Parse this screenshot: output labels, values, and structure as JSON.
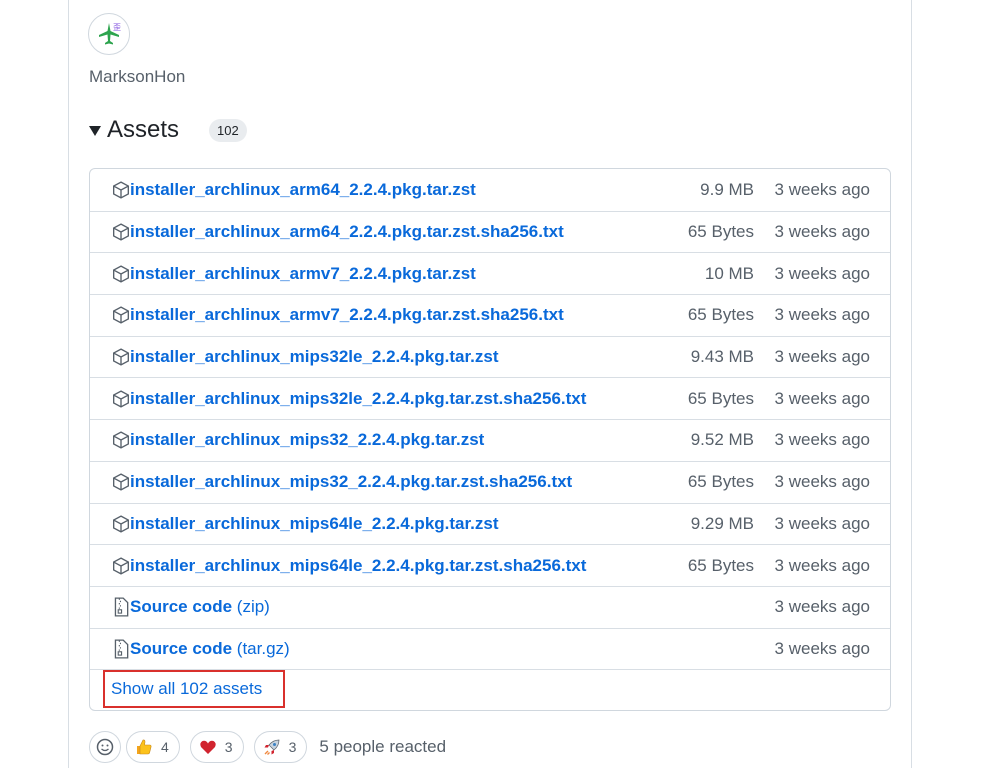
{
  "author": {
    "name": "MarksonHon",
    "avatar_icon": "airplane-avatar-icon"
  },
  "assets": {
    "title": "Assets",
    "count": "102",
    "items": [
      {
        "name": "installer_archlinux_arm64_2.2.4.pkg.tar.zst",
        "suffix": "",
        "size": "9.9 MB",
        "date": "3 weeks ago",
        "icon": "package-icon"
      },
      {
        "name": "installer_archlinux_arm64_2.2.4.pkg.tar.zst.sha256.txt",
        "suffix": "",
        "size": "65 Bytes",
        "date": "3 weeks ago",
        "icon": "package-icon"
      },
      {
        "name": "installer_archlinux_armv7_2.2.4.pkg.tar.zst",
        "suffix": "",
        "size": "10 MB",
        "date": "3 weeks ago",
        "icon": "package-icon"
      },
      {
        "name": "installer_archlinux_armv7_2.2.4.pkg.tar.zst.sha256.txt",
        "suffix": "",
        "size": "65 Bytes",
        "date": "3 weeks ago",
        "icon": "package-icon"
      },
      {
        "name": "installer_archlinux_mips32le_2.2.4.pkg.tar.zst",
        "suffix": "",
        "size": "9.43 MB",
        "date": "3 weeks ago",
        "icon": "package-icon"
      },
      {
        "name": "installer_archlinux_mips32le_2.2.4.pkg.tar.zst.sha256.txt",
        "suffix": "",
        "size": "65 Bytes",
        "date": "3 weeks ago",
        "icon": "package-icon"
      },
      {
        "name": "installer_archlinux_mips32_2.2.4.pkg.tar.zst",
        "suffix": "",
        "size": "9.52 MB",
        "date": "3 weeks ago",
        "icon": "package-icon"
      },
      {
        "name": "installer_archlinux_mips32_2.2.4.pkg.tar.zst.sha256.txt",
        "suffix": "",
        "size": "65 Bytes",
        "date": "3 weeks ago",
        "icon": "package-icon"
      },
      {
        "name": "installer_archlinux_mips64le_2.2.4.pkg.tar.zst",
        "suffix": "",
        "size": "9.29 MB",
        "date": "3 weeks ago",
        "icon": "package-icon"
      },
      {
        "name": "installer_archlinux_mips64le_2.2.4.pkg.tar.zst.sha256.txt",
        "suffix": "",
        "size": "65 Bytes",
        "date": "3 weeks ago",
        "icon": "package-icon"
      },
      {
        "name": "Source code",
        "suffix": "(zip)",
        "size": "",
        "date": "3 weeks ago",
        "icon": "file-zip-icon"
      },
      {
        "name": "Source code",
        "suffix": "(tar.gz)",
        "size": "",
        "date": "3 weeks ago",
        "icon": "file-zip-icon"
      }
    ],
    "show_all_label": "Show all 102 assets"
  },
  "reactions": {
    "items": [
      {
        "icon": "thumbs-up-icon",
        "count": "4"
      },
      {
        "icon": "heart-icon",
        "count": "3"
      },
      {
        "icon": "rocket-icon",
        "count": "3"
      }
    ],
    "summary": "5 people reacted"
  },
  "colors": {
    "link": "#0969da",
    "muted": "#57606a",
    "border": "#d0d7de",
    "highlight": "#d9302c"
  }
}
